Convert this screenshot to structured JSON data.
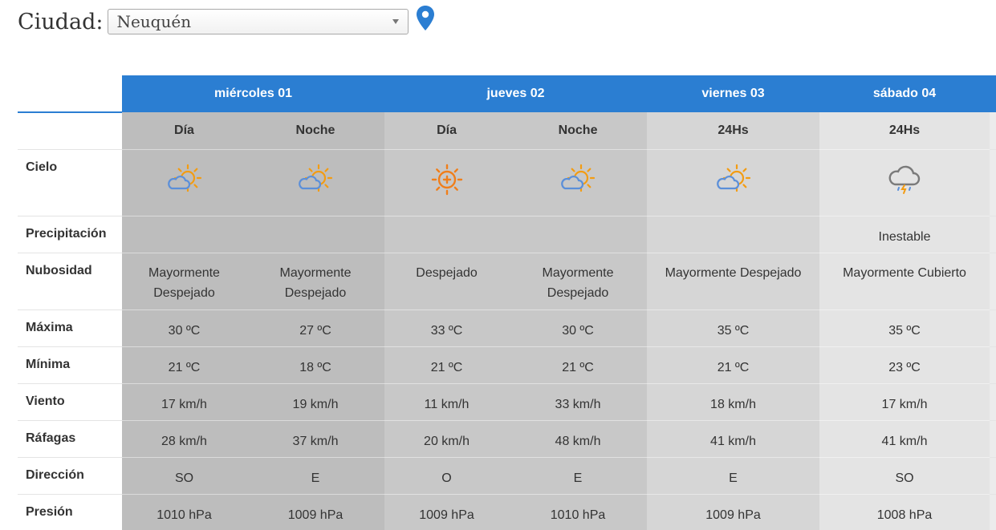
{
  "city": {
    "label": "Ciudad:",
    "selected": "Neuquén"
  },
  "days": [
    {
      "label": "miércoles 01"
    },
    {
      "label": "jueves 02"
    },
    {
      "label": "viernes 03"
    },
    {
      "label": "sábado 04"
    }
  ],
  "periods": [
    "Día",
    "Noche",
    "Día",
    "Noche",
    "24Hs",
    "24Hs"
  ],
  "row_labels": {
    "cielo": "Cielo",
    "precipitacion": "Precipitación",
    "nubosidad": "Nubosidad",
    "maxima": "Máxima",
    "minima": "Mínima",
    "viento": "Viento",
    "rafagas": "Ráfagas",
    "direccion": "Dirección",
    "presion": "Presión"
  },
  "cielo_icons": [
    "sun-cloud-icon",
    "sun-cloud-icon",
    "sun-icon",
    "sun-cloud-icon",
    "sun-cloud-icon",
    "storm-cloud-icon"
  ],
  "precipitacion": [
    "",
    "",
    "",
    "",
    "",
    "Inestable"
  ],
  "nubosidad": [
    [
      "Mayormente",
      "Despejado"
    ],
    [
      "Mayormente",
      "Despejado"
    ],
    [
      "Despejado",
      ""
    ],
    [
      "Mayormente",
      "Despejado"
    ],
    [
      "Mayormente Despejado",
      ""
    ],
    [
      "Mayormente Cubierto",
      ""
    ]
  ],
  "maxima": [
    "30 ºC",
    "27 ºC",
    "33 ºC",
    "30 ºC",
    "35 ºC",
    "35 ºC"
  ],
  "minima": [
    "21 ºC",
    "18 ºC",
    "21 ºC",
    "21 ºC",
    "21 ºC",
    "23 ºC"
  ],
  "viento": [
    "17 km/h",
    "19 km/h",
    "11 km/h",
    "33 km/h",
    "18 km/h",
    "17 km/h"
  ],
  "rafagas": [
    "28 km/h",
    "37 km/h",
    "20 km/h",
    "48 km/h",
    "41 km/h",
    "41 km/h"
  ],
  "direccion": [
    "SO",
    "E",
    "O",
    "E",
    "E",
    "SO"
  ],
  "presion": [
    "1010 hPa",
    "1009 hPa",
    "1009 hPa",
    "1010 hPa",
    "1009 hPa",
    "1008 hPa"
  ],
  "colors": {
    "header_blue": "#2b7ed2",
    "pin_blue": "#2b7ed2",
    "sun_orange": "#f39c12",
    "cloud_blue": "#5b8fd9",
    "storm_gray": "#888888"
  }
}
